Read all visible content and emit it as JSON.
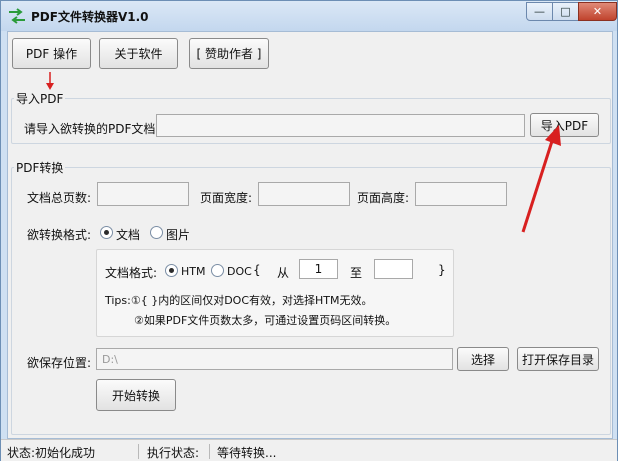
{
  "window": {
    "title": "PDF文件转换器V1.0",
    "min_glyph": "—",
    "max_glyph": "□",
    "close_glyph": "✕"
  },
  "toolbar": {
    "pdf_ops": "PDF 操作",
    "about": "关于软件",
    "sponsor": "[ 赞助作者 ]"
  },
  "import_group": {
    "title": "导入PDF",
    "prompt": "请导入欲转换的PDF文档:",
    "path_value": "",
    "import_button": "导入PDF"
  },
  "convert_group": {
    "title": "PDF转换",
    "total_pages_label": "文档总页数:",
    "page_width_label": "页面宽度:",
    "page_height_label": "页面高度:",
    "format_label": "欲转换格式:",
    "format_options": [
      "文档",
      "图片"
    ],
    "format_selected": "文档",
    "doc_format_label": "文档格式:",
    "doc_options": [
      "HTM",
      "DOC"
    ],
    "doc_selected": "HTM",
    "bracket_open": "{",
    "from_label": "从",
    "from_value": "1",
    "to_label": "至",
    "to_value": "",
    "bracket_close": "}",
    "tip1": "Tips:①{ }内的区间仅对DOC有效，对选择HTM无效。",
    "tip2": "②如果PDF文件页数太多，可通过设置页码区间转换。",
    "save_label": "欲保存位置:",
    "save_path": "D:\\",
    "choose_button": "选择",
    "open_dir_button": "打开保存目录",
    "start_button": "开始转换"
  },
  "status": {
    "state": "状态:初始化成功",
    "exec_label": "执行状态:",
    "exec_value": "等待转换..."
  },
  "colors": {
    "annotation_arrow": "#d82020",
    "window_frame": "#cfe0f2",
    "close_button": "#c0432d"
  }
}
